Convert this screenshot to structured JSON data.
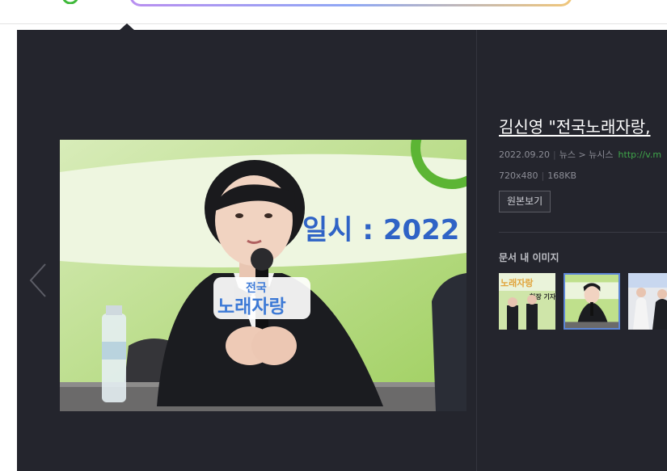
{
  "viewer": {
    "title": "김신영 \"전국노래자랑,",
    "meta": {
      "date": "2022.09.20",
      "category": "뉴스",
      "arrow": ">",
      "source": "뉴시스",
      "url": "http://v.m"
    },
    "dimensions": "720x480",
    "file_size": "168KB",
    "original_button_label": "원본보기",
    "doc_images_label": "문서 내 이미지"
  },
  "photo": {
    "sign_text": "일시 : 2022",
    "badge_line1": "전국",
    "badge_line2": "노래자랑"
  },
  "thumbnails": [
    {
      "name": "thumbnail-1",
      "active": false,
      "text_line1": "노래자랑",
      "text_line2": "현장 기자"
    },
    {
      "name": "thumbnail-2",
      "active": true
    },
    {
      "name": "thumbnail-3",
      "active": false
    }
  ],
  "icons": {
    "prev": "chevron-left-icon"
  },
  "colors": {
    "viewer_bg": "#24252d",
    "url_green": "#3fa64a",
    "active_thumb_border": "#5d86d6",
    "photo_sign_blue": "#2f63c6"
  }
}
